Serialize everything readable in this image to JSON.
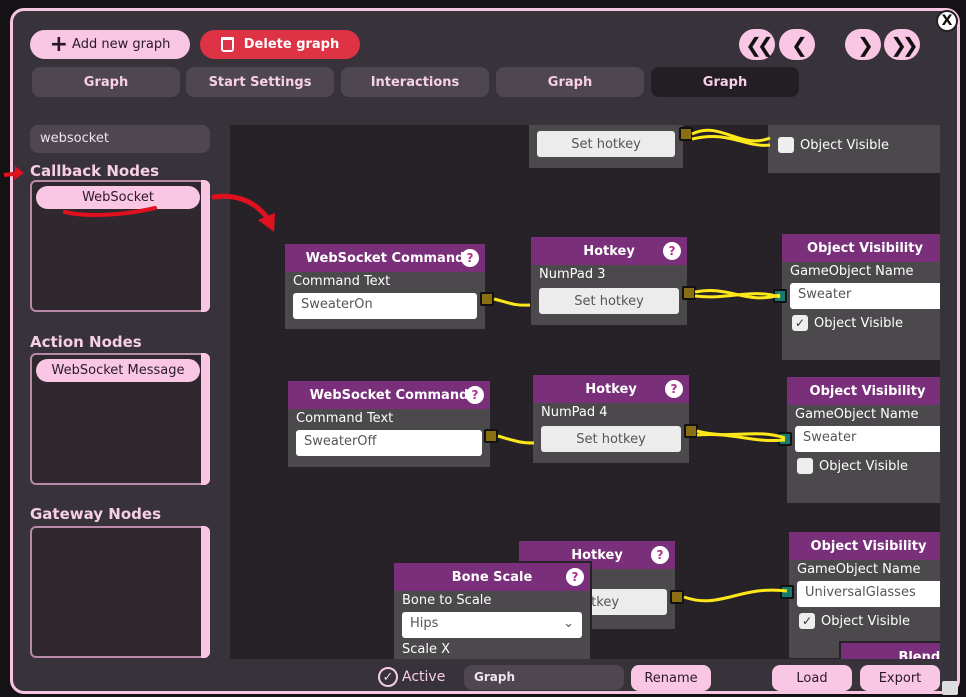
{
  "window": {
    "close_label": "X"
  },
  "toolbar": {
    "add_label": "Add new graph",
    "delete_label": "Delete graph"
  },
  "tabs": [
    {
      "label": "Graph"
    },
    {
      "label": "Start Settings"
    },
    {
      "label": "Interactions"
    },
    {
      "label": "Graph"
    },
    {
      "label": "Graph"
    }
  ],
  "sidebar": {
    "search_value": "websocket",
    "callback_title": "Callback Nodes",
    "callback_items": [
      "WebSocket"
    ],
    "action_title": "Action Nodes",
    "action_items": [
      "WebSocket Message"
    ],
    "gateway_title": "Gateway Nodes"
  },
  "nodes": {
    "top_hotkey_btn": "Set hotkey",
    "top_visible": "Object Visible",
    "ws1": {
      "title": "WebSocket Command",
      "label": "Command Text",
      "value": "SweaterOn"
    },
    "hk1": {
      "title": "Hotkey",
      "key": "NumPad 3",
      "btn": "Set hotkey"
    },
    "ov1": {
      "title": "Object Visibility",
      "label": "GameObject Name",
      "value": "Sweater",
      "check": "Object Visible"
    },
    "ws2": {
      "title": "WebSocket Command",
      "label": "Command Text",
      "value": "SweaterOff"
    },
    "hk2": {
      "title": "Hotkey",
      "key": "NumPad 4",
      "btn": "Set hotkey"
    },
    "ov2": {
      "title": "Object Visibility",
      "label": "GameObject Name",
      "value": "Sweater",
      "check": "Object Visible"
    },
    "hk3": {
      "title": "Hotkey",
      "btn_partial": "hotkey"
    },
    "bs": {
      "title": "Bone Scale",
      "label": "Bone to Scale",
      "value": "Hips",
      "label2": "Scale X"
    },
    "ov3": {
      "title": "Object Visibility",
      "label": "GameObject Name",
      "value": "UniversalGlasses",
      "check": "Object Visible"
    },
    "partial_title": "Blende"
  },
  "footer": {
    "active_label": "Active",
    "graph_name": "Graph",
    "rename": "Rename",
    "load": "Load",
    "export": "Export"
  },
  "colors": {
    "accent_pink": "#f9c6e3",
    "delete_red": "#dd3345",
    "node_header": "#7a2f7a",
    "wire": "#ffe81a",
    "annotation_red": "#e0101e"
  }
}
